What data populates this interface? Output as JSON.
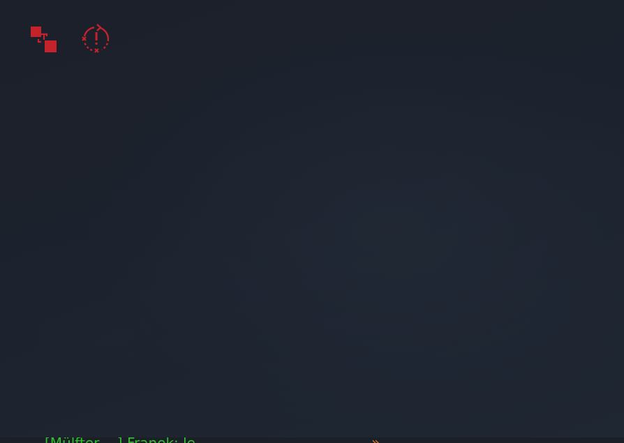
{
  "toolbar": {
    "buttons": [
      {
        "icon": "fullscreen-toggle-icon"
      },
      {
        "icon": "reset-alert-icon"
      }
    ],
    "accent_color": "#c4232b"
  },
  "chat": {
    "line": "[Mülfter ...] Franek: le",
    "arrow_glyph": "»",
    "text_color": "#2fbf2f",
    "arrow_color": "#d4782a"
  }
}
